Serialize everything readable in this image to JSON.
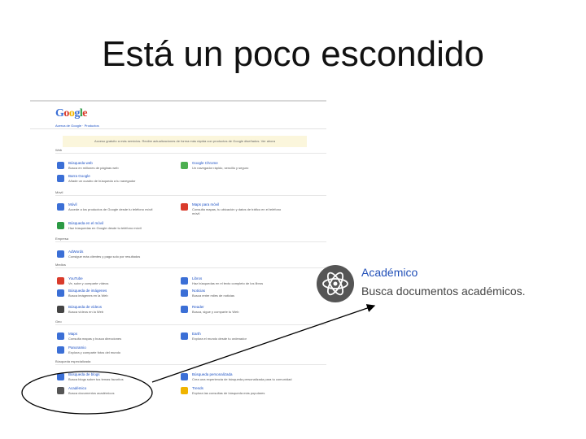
{
  "slide": {
    "title": "Está un poco escondido"
  },
  "screenshot": {
    "logo_letters": [
      "G",
      "o",
      "o",
      "g",
      "l",
      "e"
    ],
    "logo_colors": [
      "#3b6fd6",
      "#d93b2b",
      "#f0b400",
      "#3b6fd6",
      "#2b9a44",
      "#d93b2b"
    ],
    "subnav": "Acerca de Google · Productos",
    "notice": "Acceso gratuito a más servicios. Recibe actualizaciones de forma más rápida con productos de Google diseñados. Ver ahora",
    "sections": [
      {
        "label": "Web"
      },
      {
        "label": "Móvil"
      },
      {
        "label": "Empresa"
      },
      {
        "label": "Medios"
      },
      {
        "label": "Geo"
      },
      {
        "label": "Búsqueda especializada"
      }
    ],
    "items": [
      {
        "name": "Búsqueda web",
        "desc": "Busca en millones de páginas web",
        "icon": "search-icon",
        "color": "#3b6fd6"
      },
      {
        "name": "Google Chrome",
        "desc": "Un navegador rápido, sencillo y seguro",
        "icon": "chrome-icon",
        "color": "#4caf50"
      },
      {
        "name": "Barra Google",
        "desc": "Añade un cuadro de búsqueda a tu navegador",
        "icon": "toolbar-icon",
        "color": "#3b6fd6"
      },
      {
        "name": "Móvil",
        "desc": "Accede a los productos de Google desde tu teléfono móvil",
        "icon": "phone-icon",
        "color": "#3b6fd6"
      },
      {
        "name": "Maps para móvil",
        "desc": "Consulta mapas, tu ubicación y datos de tráfico en el teléfono",
        "extra": "móvil",
        "icon": "maps-icon",
        "color": "#d93b2b"
      },
      {
        "name": "Búsqueda en el móvil",
        "desc": "Haz búsquedas en Google desde tu teléfono móvil",
        "icon": "mobile-search-icon",
        "color": "#2b9a44"
      },
      {
        "name": "AdWords",
        "desc": "Consigue más clientes y paga solo por resultados",
        "icon": "adwords-icon",
        "color": "#3b6fd6"
      },
      {
        "name": "YouTube",
        "desc": "Ve, sube y comparte vídeos",
        "icon": "youtube-icon",
        "color": "#d93b2b"
      },
      {
        "name": "Libros",
        "desc": "Haz búsquedas en el texto completo de los libros",
        "icon": "books-icon",
        "color": "#3b6fd6"
      },
      {
        "name": "Búsqueda de imágenes",
        "desc": "Busca imágenes en la Web",
        "icon": "images-icon",
        "color": "#3b6fd6"
      },
      {
        "name": "Noticias",
        "desc": "Busca entre miles de noticias",
        "icon": "news-icon",
        "color": "#3b6fd6"
      },
      {
        "name": "Búsqueda de vídeos",
        "desc": "Busca vídeos en la Web",
        "icon": "video-icon",
        "color": "#444444"
      },
      {
        "name": "Reader",
        "desc": "Busca, sigue y comparte tu Web",
        "icon": "reader-icon",
        "color": "#3b6fd6"
      },
      {
        "name": "Maps",
        "desc": "Consulta mapas y busca direcciones",
        "icon": "maps-pin-icon",
        "color": "#3b6fd6"
      },
      {
        "name": "Earth",
        "desc": "Explora el mundo desde tu ordenador",
        "icon": "earth-icon",
        "color": "#3b6fd6"
      },
      {
        "name": "Panoramio",
        "desc": "Explora y comparte fotos del mundo",
        "icon": "panoramio-icon",
        "color": "#3b6fd6"
      },
      {
        "name": "Búsqueda de blogs",
        "desc": "Busca blogs sobre tus temas favoritos",
        "icon": "blog-search-icon",
        "color": "#3b6fd6"
      },
      {
        "name": "Búsqueda personalizada",
        "desc": "Crea una experiencia de búsqueda personalizada para tu comunidad",
        "icon": "custom-search-icon",
        "color": "#3b6fd6"
      },
      {
        "name": "Académico",
        "desc": "Busca documentos académicos",
        "icon": "scholar-icon",
        "color": "#555555"
      },
      {
        "name": "Trends",
        "desc": "Explora las consultas de búsqueda más populares",
        "icon": "trends-icon",
        "color": "#f0b400"
      }
    ]
  },
  "zoom": {
    "title": "Académico",
    "desc": "Busca documentos académicos."
  }
}
